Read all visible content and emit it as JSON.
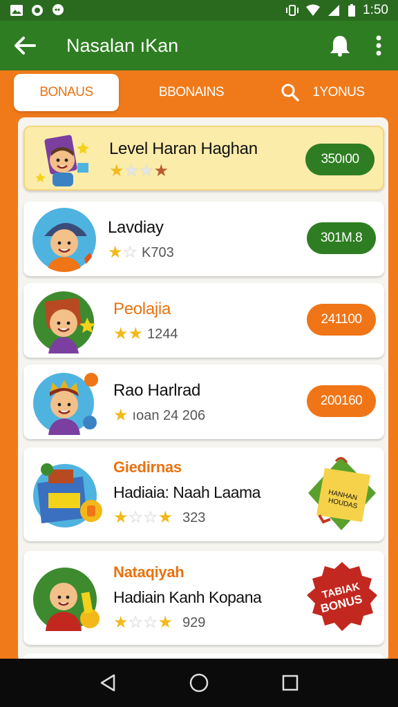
{
  "status_bar": {
    "time": "1:50",
    "left_icons": [
      "gallery-icon",
      "camera-icon",
      "chat-icon"
    ],
    "right_icons": [
      "vibrate-icon",
      "wifi-icon",
      "signal-icon",
      "battery-icon"
    ]
  },
  "app_bar": {
    "title": "Nasalan ıKan",
    "back_icon": "back-arrow-icon",
    "actions": [
      "bell-icon",
      "more-vert-icon"
    ]
  },
  "tabs": [
    {
      "label": "BONAUS",
      "active": true
    },
    {
      "label": "BBONAINS",
      "active": false
    },
    {
      "label": "1YONUS",
      "active": false,
      "icon": "search-icon"
    }
  ],
  "items": [
    {
      "title": "Level Haran Haghan",
      "stars": "1/4",
      "meta": "",
      "action": "350ı00",
      "action_color": "green",
      "highlight": true
    },
    {
      "title": "Lavdiay",
      "stars": "1/2",
      "meta": "K703",
      "action": "301M.8",
      "action_color": "green"
    },
    {
      "title": "Peolajia",
      "stars": "2/2",
      "meta": "1244",
      "action": "241100",
      "action_color": "orange"
    },
    {
      "title": "Rao Harlrad",
      "stars": "1/1",
      "meta": "ıoan 24 206",
      "action": "200160",
      "action_color": "orange"
    },
    {
      "subtitle": "Giedirnas",
      "name": "Hadiaia: Naah Laama",
      "stars": "1/4",
      "meta": "323",
      "tag_lines": [
        "HANHAN",
        "HOUDAS"
      ]
    },
    {
      "subtitle": "Nataqiyah",
      "name": "Hadiain Kanh Kopana",
      "stars": "1/4",
      "meta": "929",
      "tag_lines": [
        "TABIAK",
        "BONUS"
      ]
    }
  ],
  "colors": {
    "primary_green": "#2e7d22",
    "status_green": "#2a6a1f",
    "accent_orange": "#f07a1a",
    "highlight_yellow": "#fcecaa",
    "star_gold": "#f3b81a"
  },
  "nav": [
    "back-triangle-icon",
    "home-circle-icon",
    "recents-square-icon"
  ]
}
